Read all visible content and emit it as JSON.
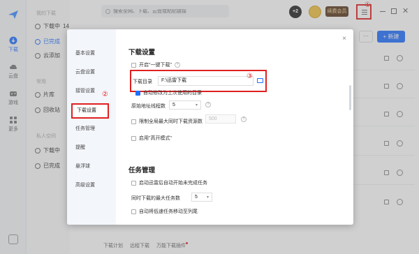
{
  "rail": {
    "items": [
      {
        "label": "下载",
        "active": true
      },
      {
        "label": "云盘"
      },
      {
        "label": "游戏"
      },
      {
        "label": "更多"
      }
    ]
  },
  "sidebar": {
    "section_my": "我的下载",
    "downloading": "下载中",
    "downloading_count": "14",
    "completed": "已完成",
    "cloud_add": "云添加",
    "section_common": "常用",
    "library": "片库",
    "recycle": "回收站",
    "section_private": "私人空间",
    "private_downloading": "下载中",
    "private_completed": "已完成"
  },
  "topbar": {
    "search_placeholder": "搜索全网、下载、云盘或粘贴链接",
    "badge": "+2",
    "vip": "续费会员",
    "annot_1": "①"
  },
  "toolbar": {
    "more": "···",
    "new": "+ 新建"
  },
  "bottom": {
    "plan": "下载计划",
    "remote": "远程下载",
    "plugin": "万能下载插件"
  },
  "dialog": {
    "nav": [
      {
        "label": "基本设置"
      },
      {
        "label": "云盘设置"
      },
      {
        "label": "接管设置"
      },
      {
        "label": "下载设置",
        "active": true
      },
      {
        "label": "任务管理"
      },
      {
        "label": "提醒"
      },
      {
        "label": "悬浮球"
      },
      {
        "label": "高级设置"
      }
    ],
    "annot_2": "②",
    "close": "×",
    "download_title": "下载设置",
    "one_click": "开启\"一键下载\"",
    "dir_label": "下载目录",
    "dir_value": "F:\\迅雷下载",
    "annot_3": "③",
    "auto_last_dir": "自动修改为上次使用的目录",
    "origin_threads_label": "原始地址线程数",
    "origin_threads_value": "5",
    "limit_global": "限制全局最大同时下载资源数",
    "limit_value": "500",
    "enable_turbo": "启用\"高开模式\"",
    "task_title": "任务管理",
    "auto_start": "启动迅雷后自动开始未完成任务",
    "max_tasks_label": "同时下载的最大任务数",
    "max_tasks_value": "5",
    "auto_move_slow": "自动将低速任务移动至列尾"
  },
  "colors": {
    "accent": "#1f6fff",
    "annotation": "#e02020"
  }
}
